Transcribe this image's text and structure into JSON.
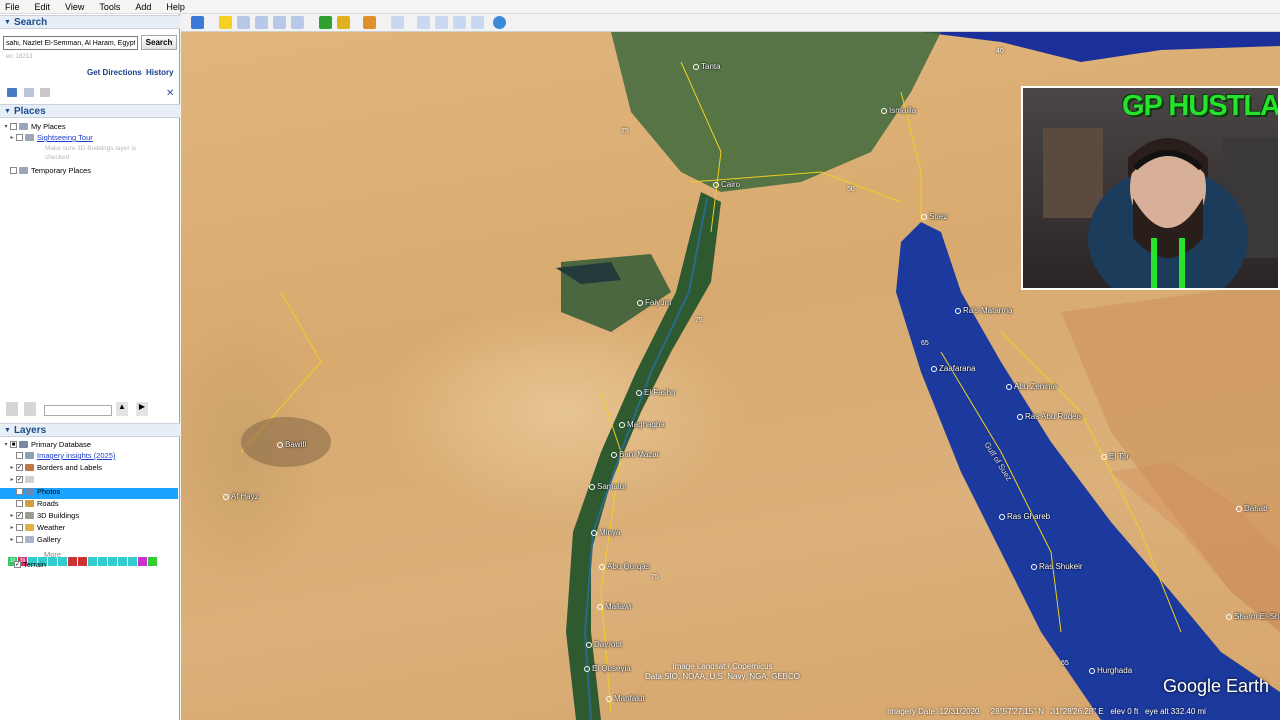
{
  "menu": [
    "File",
    "Edit",
    "View",
    "Tools",
    "Add",
    "Help"
  ],
  "search": {
    "title": "Search",
    "query": "sahi, Nazlet El-Semman, Al Haram, Egypt",
    "button": "Search",
    "hint": "ex: 18213",
    "get_directions": "Get Directions",
    "history": "History"
  },
  "places": {
    "title": "Places",
    "my_places": "My Places",
    "tour": "Sightseeing Tour",
    "note": "Make sure 3D Buildings layer is checked",
    "temporary": "Temporary Places"
  },
  "layers": {
    "title": "Layers",
    "items": [
      "Primary Database",
      "Imagery insights (2025)",
      "Borders and Labels",
      "Places",
      "Photos",
      "Roads",
      "3D Buildings",
      "Weather",
      "Gallery",
      "More",
      "Terrain"
    ]
  },
  "map": {
    "cities": [
      "Tanta",
      "Ismailia",
      "Cairo",
      "Suez",
      "Faiyum",
      "El Fashn",
      "Maghagha",
      "Bani Mazar",
      "Samalut",
      "Minya",
      "Abu Qurqas",
      "Mallawi",
      "Dayrout",
      "El Quseyia",
      "Manfalut",
      "Bawiti",
      "Al Hayz",
      "Ra's Matarma",
      "Zaafarana",
      "Abu Zenima",
      "Ras Abu Rudeis",
      "El Tor",
      "Ras Shukeir",
      "Ras Ghareb",
      "Hurghada",
      "Dahab",
      "Sharm El-Sheikh"
    ],
    "shields": [
      "75",
      "50",
      "65",
      "65",
      "40",
      "75",
      "75"
    ],
    "gulf_label": "Gulf of Suez",
    "credit_line1": "Image Landsat / Copernicus",
    "credit_line2": "Data SIO, NOAA, U.S. Navy, NGA, GEBCO",
    "imagery_date": "Imagery Date: 12/31/2020",
    "lat": "28°57'27.15\" N",
    "lon": "31°28'26.28\" E",
    "elev": "elev 0 ft",
    "eye_alt": "eye alt 332.40 mi",
    "brand": "Google Earth"
  },
  "overlay": {
    "title": "GP HUSTLA"
  },
  "colors": {
    "accent": "#1aa3ff",
    "header_text": "#1a4c8c",
    "overlay_green": "#27e32d"
  }
}
